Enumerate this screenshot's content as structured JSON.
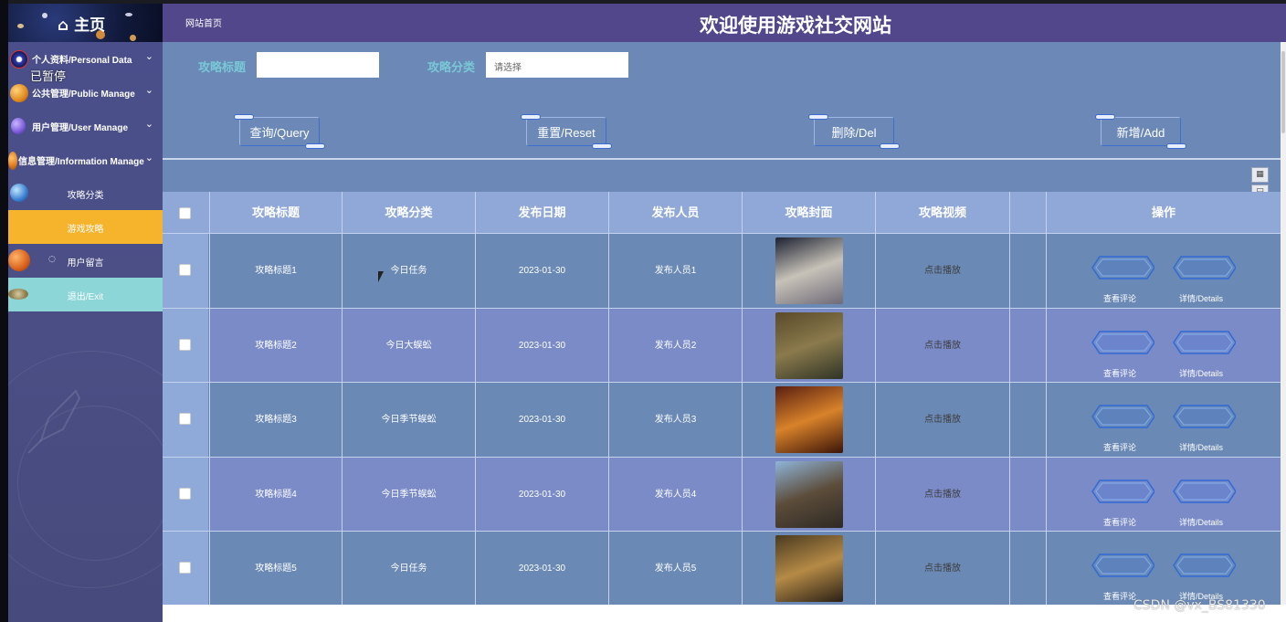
{
  "sidebar": {
    "home_label": "⌂ 主页",
    "paused_overlay": "已暂停",
    "items": [
      {
        "label": "个人资料/Personal Data",
        "chevron": "⌄",
        "icon": "planet-atom-icon"
      },
      {
        "label": "公共管理/Public Manage",
        "chevron": "⌄",
        "icon": "planet-orange-icon"
      },
      {
        "label": "用户管理/User Manage",
        "chevron": "⌄",
        "icon": "planet-purple-icon"
      },
      {
        "label": "信息管理/Information Manage",
        "chevron": "⌄",
        "icon": "planet-orange-icon"
      }
    ],
    "sub_items": [
      {
        "label": "攻略分类",
        "active": false
      },
      {
        "label": "游戏攻略",
        "active": true
      },
      {
        "label": "用户留言",
        "active": false
      },
      {
        "label": "退出/Exit",
        "active": false
      }
    ]
  },
  "header": {
    "breadcrumb": "网站首页",
    "title": "欢迎使用游戏社交网站"
  },
  "search": {
    "title_label": "攻略标题",
    "title_value": "",
    "category_label": "攻略分类",
    "category_placeholder": "请选择"
  },
  "actions": {
    "query": "查询/Query",
    "reset": "重置/Reset",
    "delete": "删除/Del",
    "add": "新增/Add"
  },
  "table": {
    "columns": [
      "攻略标题",
      "攻略分类",
      "发布日期",
      "发布人员",
      "攻略封面",
      "攻略视频",
      "",
      "操作"
    ],
    "rows": [
      {
        "title": "攻略标题1",
        "category": "今日任务",
        "date": "2023-01-30",
        "author": "发布人员1",
        "video": "点击播放",
        "cover_colors": [
          "#1c2132",
          "#c7c2b8",
          "#6e6a78"
        ]
      },
      {
        "title": "攻略标题2",
        "category": "今日大蜈蚣",
        "date": "2023-01-30",
        "author": "发布人员2",
        "video": "点击播放",
        "cover_colors": [
          "#5a4a2a",
          "#8a7a4c",
          "#2f3326"
        ]
      },
      {
        "title": "攻略标题3",
        "category": "今日季节蜈蚣",
        "date": "2023-01-30",
        "author": "发布人员3",
        "video": "点击播放",
        "cover_colors": [
          "#5a1f10",
          "#d8822a",
          "#3c1408"
        ]
      },
      {
        "title": "攻略标题4",
        "category": "今日季节蜈蚣",
        "date": "2023-01-30",
        "author": "发布人员4",
        "video": "点击播放",
        "cover_colors": [
          "#8fb4d8",
          "#5c4c3a",
          "#2e2a24"
        ]
      },
      {
        "title": "攻略标题5",
        "category": "今日任务",
        "date": "2023-01-30",
        "author": "发布人员5",
        "video": "点击播放",
        "cover_colors": [
          "#4a3a20",
          "#b58a46",
          "#2a2015"
        ]
      }
    ],
    "row_actions": {
      "comments": "查看评论",
      "details": "详情/Details"
    }
  },
  "toolbar_icons": [
    "columns-icon",
    "export-icon",
    "print-icon"
  ],
  "watermark": "CSDN @vx_BS81330",
  "colors": {
    "header_bg": "#52478a",
    "panel_bg": "#6b88b6",
    "row_odd": "#6a89b4",
    "row_even": "#7b8bc8",
    "active_menu": "#f6b32c",
    "exit_menu": "#8cd6d8",
    "label_accent": "#79c8d6"
  }
}
